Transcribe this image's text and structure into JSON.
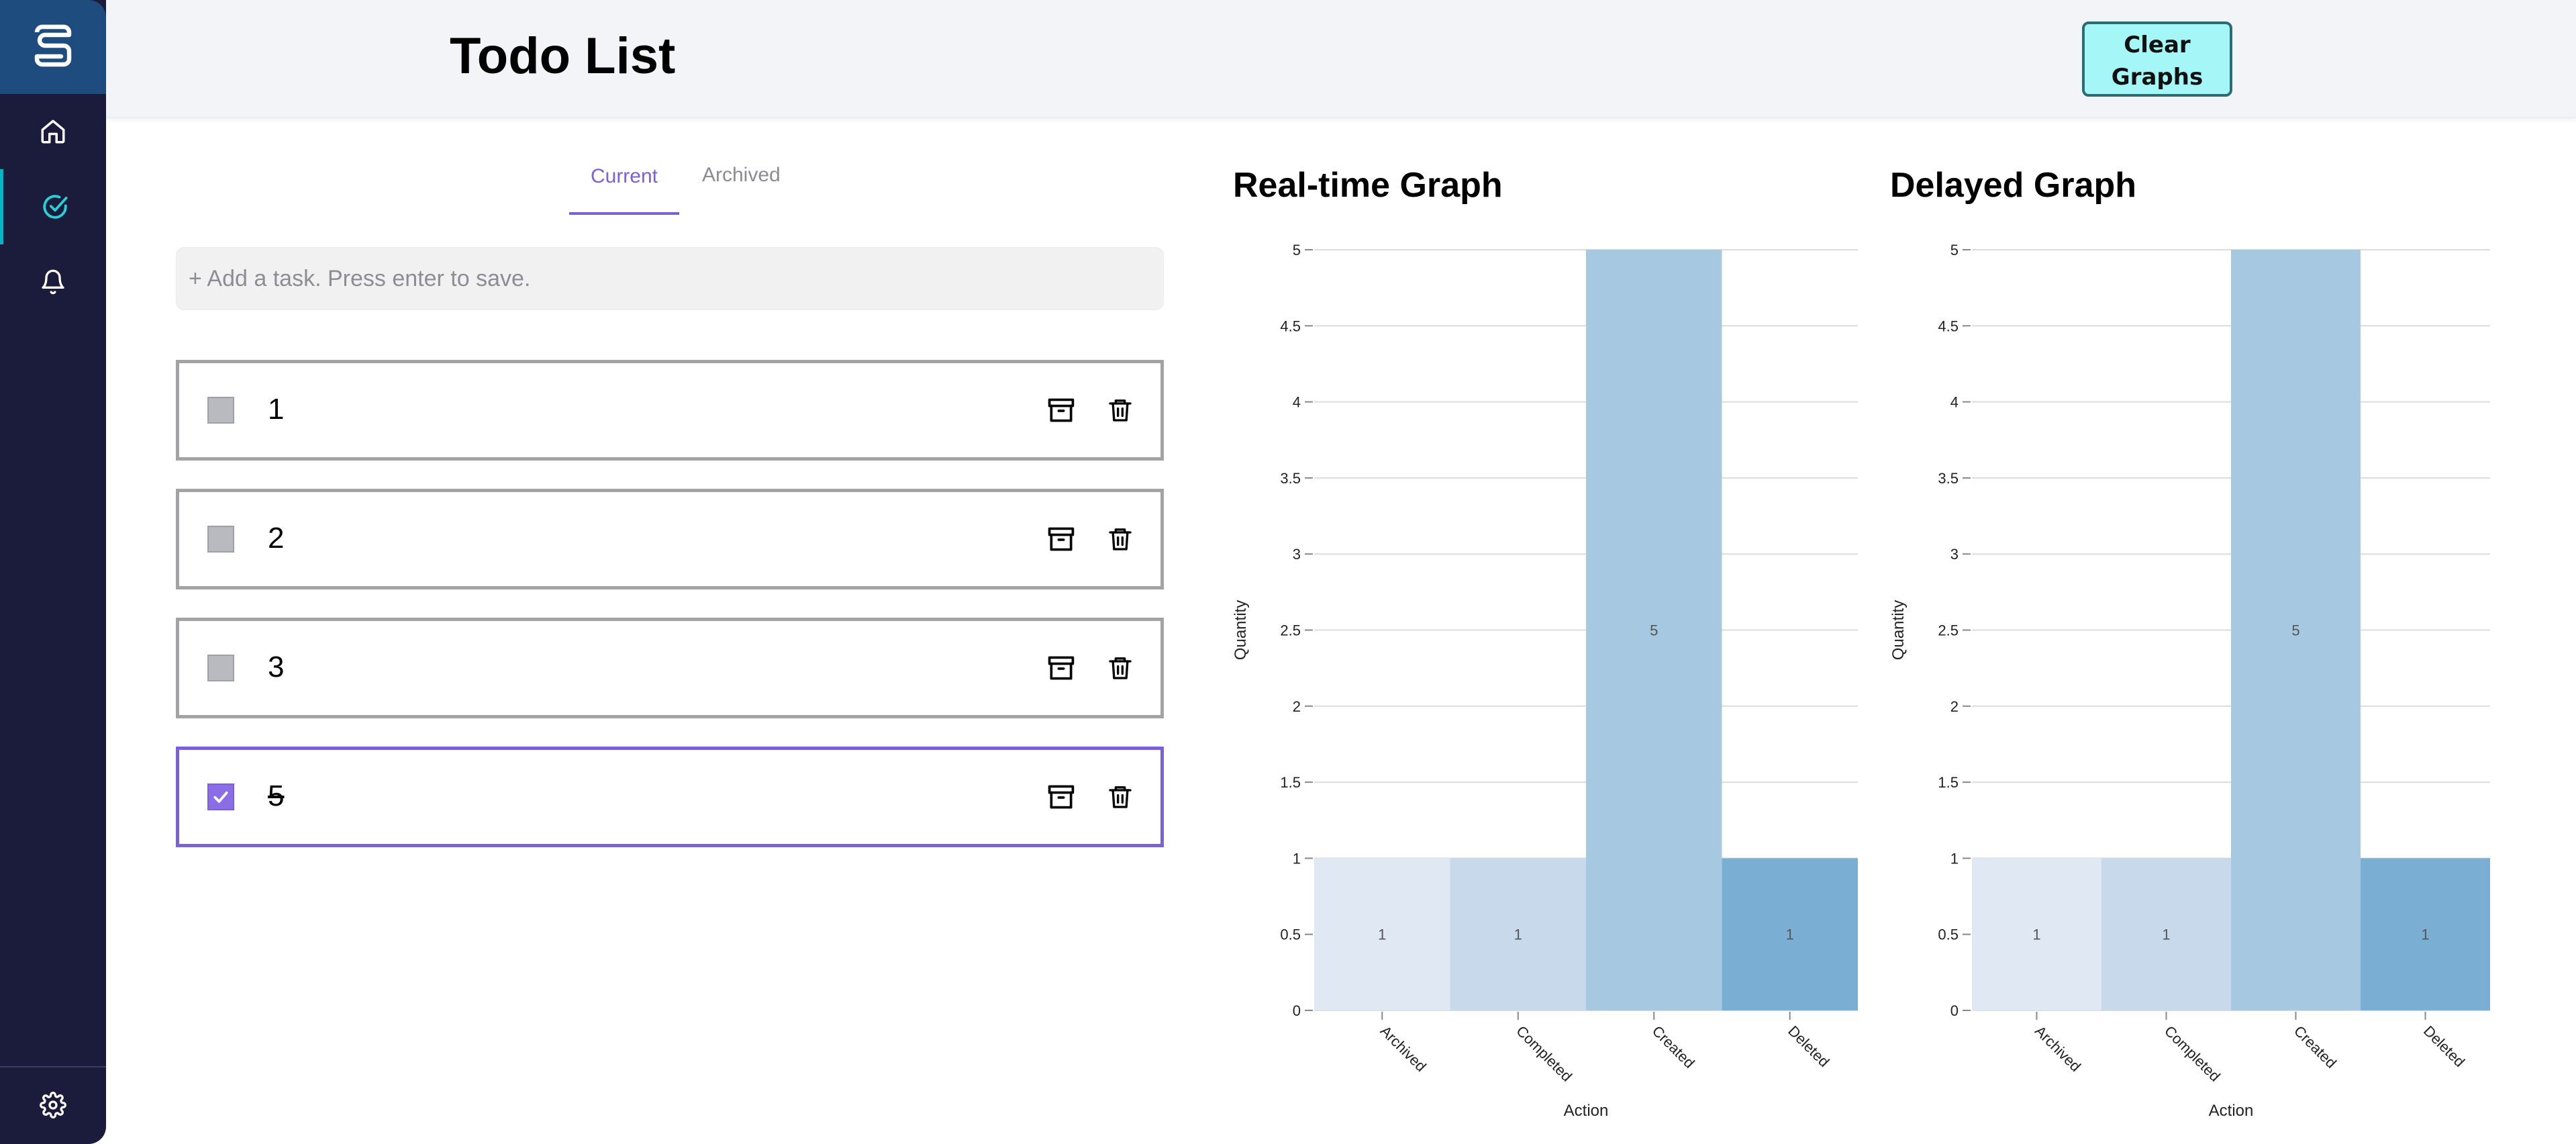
{
  "sidebar": {
    "items": [
      {
        "name": "home",
        "icon": "home-icon"
      },
      {
        "name": "todos",
        "icon": "check-circle-icon",
        "active": true
      },
      {
        "name": "notifications",
        "icon": "bell-icon"
      }
    ],
    "settings_icon": "gear-icon",
    "logo_icon": "app-logo-icon"
  },
  "header": {
    "title": "Todo List",
    "clear_button_line1": "Clear",
    "clear_button_line2": "Graphs"
  },
  "tabs": [
    {
      "label": "Current",
      "active": true
    },
    {
      "label": "Archived",
      "active": false
    }
  ],
  "task_input": {
    "placeholder": "+ Add a task. Press enter to save.",
    "value": ""
  },
  "todos": [
    {
      "text": "1",
      "checked": false
    },
    {
      "text": "2",
      "checked": false
    },
    {
      "text": "3",
      "checked": false
    },
    {
      "text": "5",
      "checked": true
    }
  ],
  "colors": {
    "accent": "#7b61d9",
    "sidebar": "#1b1c3b",
    "bar_archived": "#dfe8f3",
    "bar_completed": "#c9d9ec",
    "bar_created": "#a6c8e0",
    "bar_deleted": "#7aaed3"
  },
  "chart_data": [
    {
      "type": "bar",
      "title": "Real-time Graph",
      "xlabel": "Action",
      "ylabel": "Quantity",
      "categories": [
        "Archived",
        "Completed",
        "Created",
        "Deleted"
      ],
      "values": [
        1,
        1,
        5,
        1
      ],
      "ylim": [
        0,
        5
      ],
      "yticks": [
        "0",
        "0.5",
        "1",
        "1.5",
        "2",
        "2.5",
        "3",
        "3.5",
        "4",
        "4.5",
        "5"
      ],
      "grid": true
    },
    {
      "type": "bar",
      "title": "Delayed Graph",
      "xlabel": "Action",
      "ylabel": "Quantity",
      "categories": [
        "Archived",
        "Completed",
        "Created",
        "Deleted"
      ],
      "values": [
        1,
        1,
        5,
        1
      ],
      "ylim": [
        0,
        5
      ],
      "yticks": [
        "0",
        "0.5",
        "1",
        "1.5",
        "2",
        "2.5",
        "3",
        "3.5",
        "4",
        "4.5",
        "5"
      ],
      "grid": true
    }
  ]
}
